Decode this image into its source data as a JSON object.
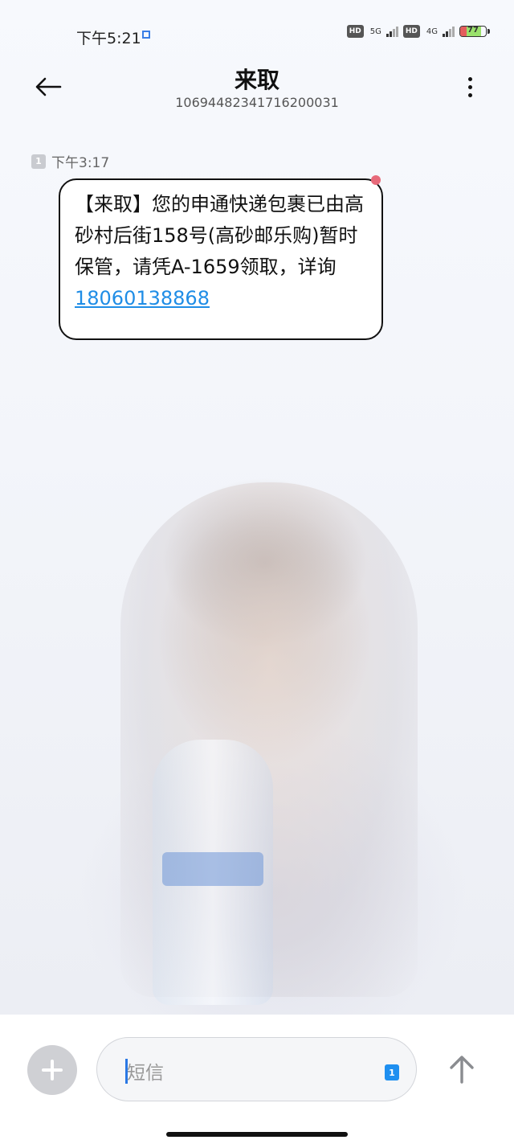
{
  "status_bar": {
    "time": "下午5:21",
    "hd1": "HD",
    "net1": "5G",
    "hd2": "HD",
    "net2": "4G",
    "battery": "77",
    "battery_level": 0.77
  },
  "header": {
    "title": "来取",
    "sender_number": "10694482341716200031"
  },
  "message": {
    "sim_slot": "1",
    "time": "下午3:17",
    "body": "【来取】您的申通快递包裹已由高砂村后街158号(高砂邮乐购)暂时保管，请凭A-1659领取，详询",
    "phone_link": "18060138868"
  },
  "composer": {
    "placeholder": "短信",
    "sim_slot": "1"
  },
  "colors": {
    "link": "#1f8de6",
    "accent": "#2a78e4",
    "sim_badge": "#1e8ff0"
  }
}
